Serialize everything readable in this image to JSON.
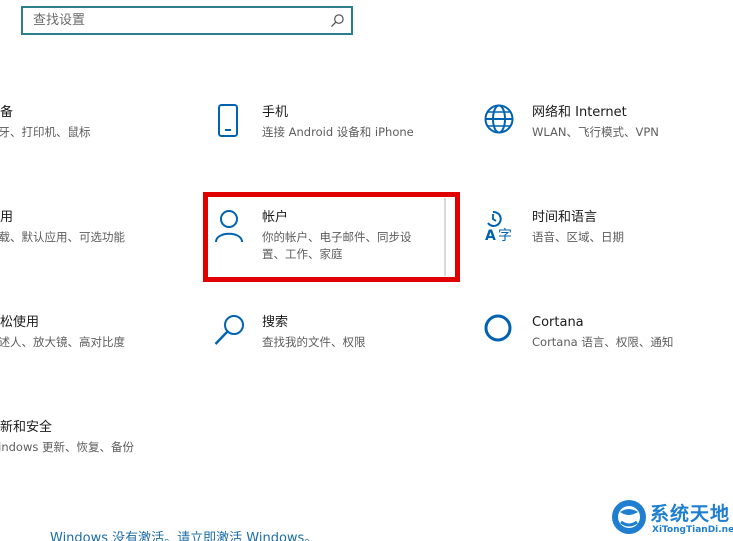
{
  "search": {
    "placeholder": "查找设置"
  },
  "tiles": {
    "devices": {
      "title": "设备",
      "desc": "蓝牙、打印机、鼠标",
      "icon": "keyboard-icon"
    },
    "phone": {
      "title": "手机",
      "desc": "连接 Android 设备和 iPhone",
      "icon": "phone-icon"
    },
    "network": {
      "title": "网络和 Internet",
      "desc": "WLAN、飞行模式、VPN",
      "icon": "globe-icon"
    },
    "apps": {
      "title": "应用",
      "desc": "卸载、默认应用、可选功能",
      "icon": "apps-icon"
    },
    "accounts": {
      "title": "帐户",
      "desc": "你的帐户、电子邮件、同步设置、工作、家庭",
      "icon": "person-icon"
    },
    "time": {
      "title": "时间和语言",
      "desc": "语音、区域、日期",
      "icon": "language-icon"
    },
    "ease": {
      "title": "轻松使用",
      "desc": "讲述人、放大镜、高对比度",
      "icon": "ease-of-access-icon"
    },
    "search": {
      "title": "搜索",
      "desc": "查找我的文件、权限",
      "icon": "magnifier-icon"
    },
    "cortana": {
      "title": "Cortana",
      "desc": "Cortana 语言、权限、通知",
      "icon": "cortana-icon"
    },
    "update": {
      "title": "更新和安全",
      "desc": "Windows 更新、恢复、备份",
      "icon": "update-icon"
    }
  },
  "activation": {
    "text": "Windows 没有激活。请立即激活 Windows。"
  },
  "watermark": {
    "title": "系统天地",
    "url": "XiTongTianDi.net"
  },
  "colors": {
    "accent": "#0063b1",
    "highlight": "#e00000",
    "search_border": "#2b7f8a",
    "link": "#1a6ca8"
  }
}
